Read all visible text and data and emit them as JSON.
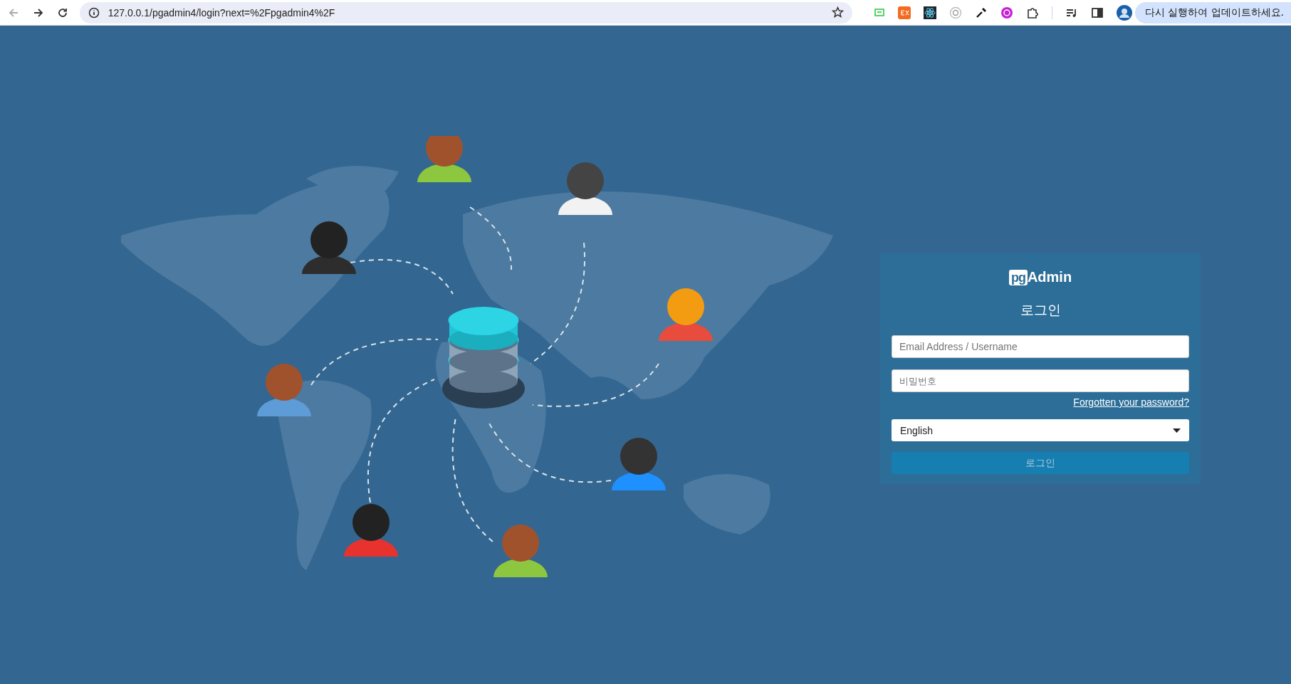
{
  "browser": {
    "nav": [
      {
        "kind": "back",
        "disabled": true
      },
      {
        "kind": "forward",
        "disabled": false
      },
      {
        "kind": "reload",
        "disabled": false
      }
    ],
    "url": "127.0.0.1/pgadmin4/login?next=%2Fpgadmin4%2F",
    "update_button": "다시 실행하여 업데이트하세요."
  },
  "login": {
    "logo_box": "pg",
    "logo_text": "Admin",
    "title": "로그인",
    "email": {
      "placeholder": "Email Address / Username"
    },
    "password": {
      "placeholder": "비밀번호"
    },
    "forgot_link": "Forgotten your password?",
    "language": "English",
    "submit": {
      "label": "로그인",
      "disabled": true
    }
  }
}
